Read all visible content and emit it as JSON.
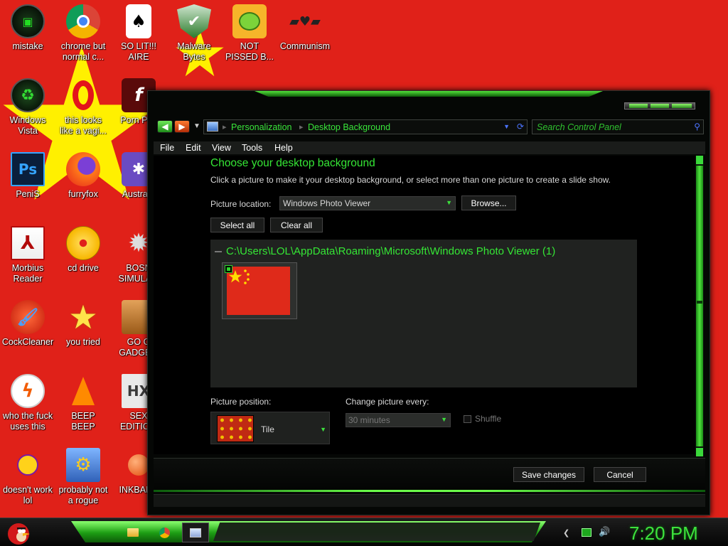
{
  "desktop": {
    "icons": [
      {
        "label": "mistake"
      },
      {
        "label": "chrome but\nnormal c..."
      },
      {
        "label": "SO LIT!!!\nAIRE"
      },
      {
        "label": "Malware\nBytes"
      },
      {
        "label": "NOT\nPISSED B..."
      },
      {
        "label": "Communism"
      },
      {
        "label": "Windows\nVista"
      },
      {
        "label": "this looks\nlike a vagi..."
      },
      {
        "label": "Porn Pl..."
      },
      {
        "label": "PeniS"
      },
      {
        "label": "furryfox"
      },
      {
        "label": "Austra..."
      },
      {
        "label": "Morbius\nReader"
      },
      {
        "label": "cd drive"
      },
      {
        "label": "BOSN\nSIMULA..."
      },
      {
        "label": "CockCleaner"
      },
      {
        "label": "you tried"
      },
      {
        "label": "GO G\nGADGE..."
      },
      {
        "label": "who the fuck\nuses this"
      },
      {
        "label": "BEEP\nBEEP"
      },
      {
        "label": "SEX\nEDITIO..."
      },
      {
        "label": "doesn't work\nlol"
      },
      {
        "label": "probably not\na rogue"
      },
      {
        "label": "INKBAL..."
      }
    ]
  },
  "window": {
    "breadcrumbs": [
      "Personalization",
      "Desktop Background"
    ],
    "search_placeholder": "Search Control Panel",
    "menu": [
      "File",
      "Edit",
      "View",
      "Tools",
      "Help"
    ],
    "title": "Choose your desktop background",
    "description": "Click a picture to make it your desktop background, or select more than one picture to create a slide show.",
    "picture_location_label": "Picture location:",
    "picture_location_value": "Windows Photo Viewer",
    "browse_label": "Browse...",
    "select_all_label": "Select all",
    "clear_all_label": "Clear all",
    "gallery_folder": "C:\\Users\\LOL\\AppData\\Roaming\\Microsoft\\Windows Photo Viewer (1)",
    "picture_position_label": "Picture position:",
    "picture_position_value": "Tile",
    "change_every_label": "Change picture every:",
    "change_every_value": "30 minutes",
    "shuffle_label": "Shuffle",
    "save_label": "Save changes",
    "cancel_label": "Cancel"
  },
  "taskbar": {
    "clock": "7:20 PM",
    "apps": [
      "folder-icon",
      "chrome-icon",
      "control-panel-icon"
    ]
  },
  "colors": {
    "desktop_bg": "#e02119",
    "accent_green": "#35e635",
    "window_bg": "#050705"
  }
}
